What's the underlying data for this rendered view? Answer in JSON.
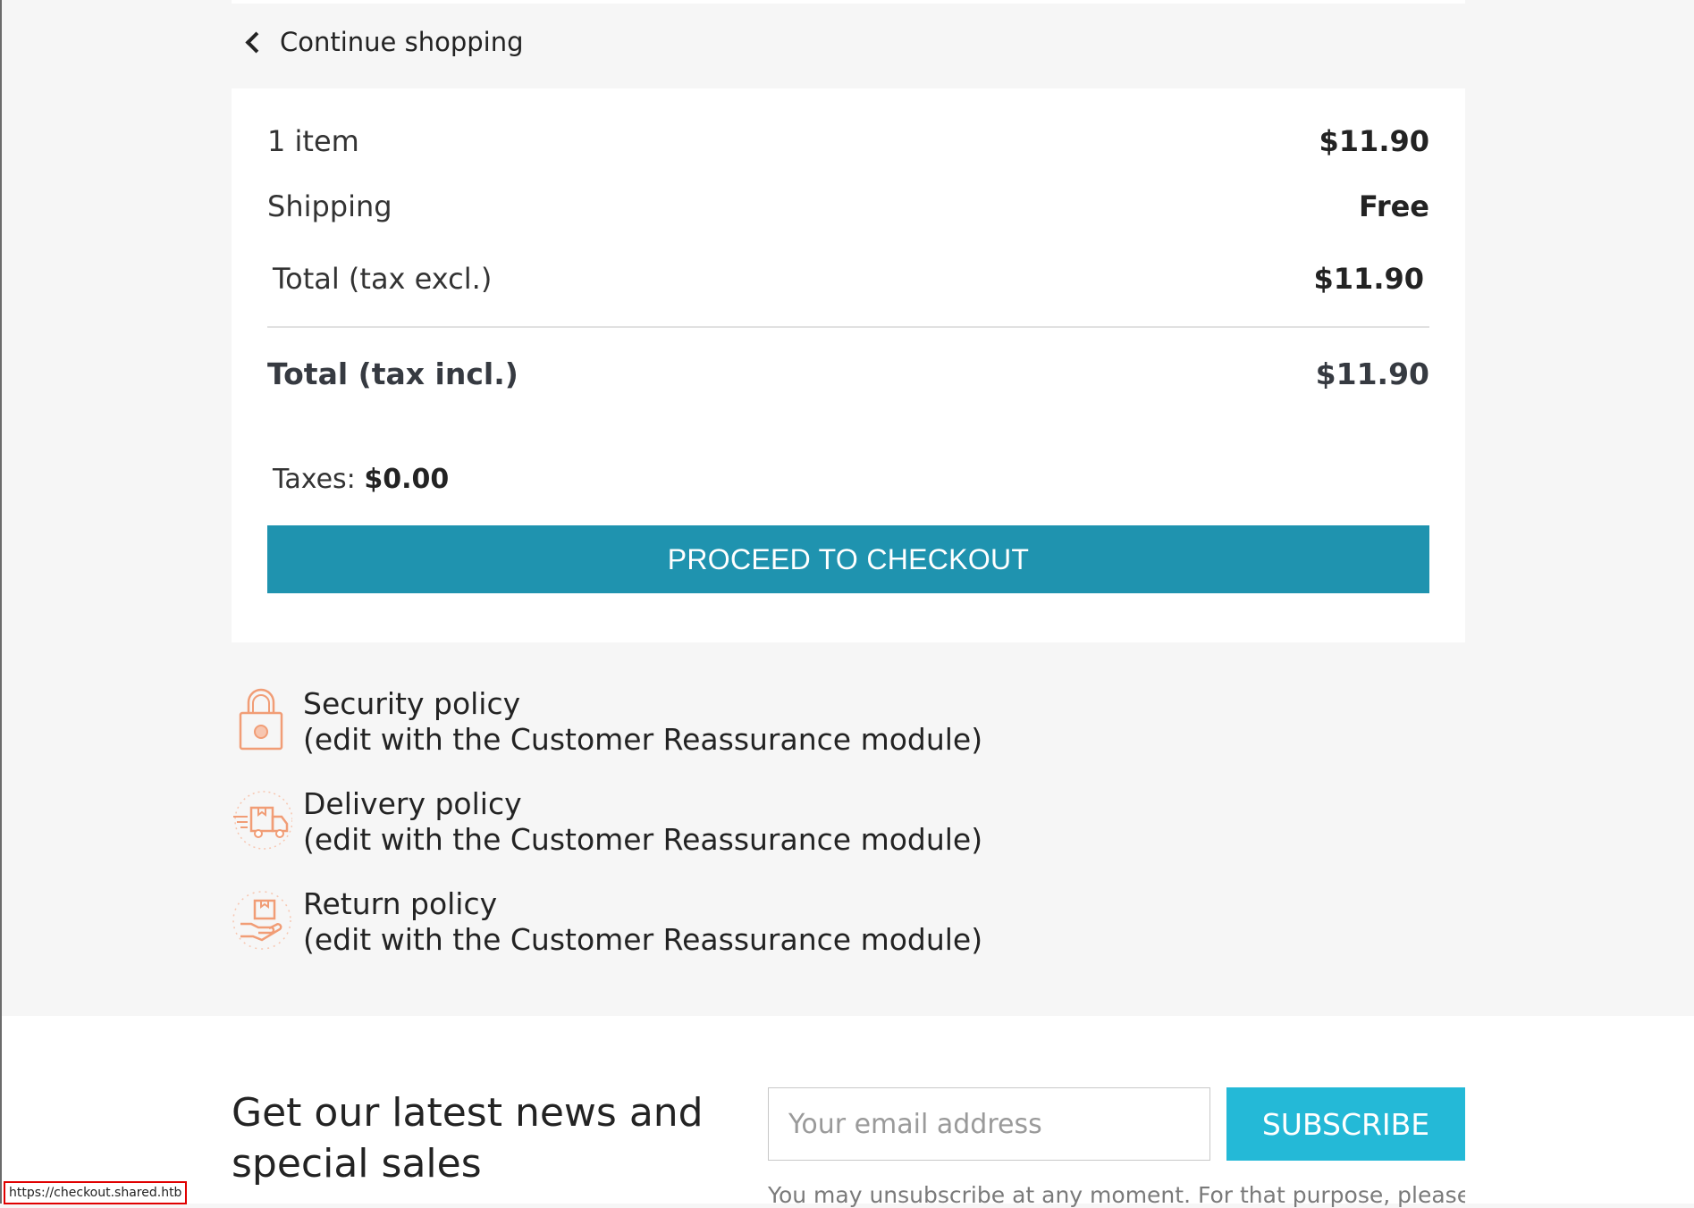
{
  "nav": {
    "continue_label": "Continue shopping"
  },
  "summary": {
    "items_label": "1 item",
    "items_value": "$11.90",
    "shipping_label": "Shipping",
    "shipping_value": "Free",
    "total_excl_label": "Total (tax excl.)",
    "total_excl_value": "$11.90",
    "total_incl_label": "Total (tax incl.)",
    "total_incl_value": "$11.90",
    "taxes_label": "Taxes:",
    "taxes_value": "$0.00",
    "checkout_label": "PROCEED TO CHECKOUT"
  },
  "reassurance": [
    {
      "icon": "lock-icon",
      "title": "Security policy",
      "subtitle": "(edit with the Customer Reassurance module)"
    },
    {
      "icon": "delivery-truck-icon",
      "title": "Delivery policy",
      "subtitle": "(edit with the Customer Reassurance module)"
    },
    {
      "icon": "return-box-icon",
      "title": "Return policy",
      "subtitle": "(edit with the Customer Reassurance module)"
    }
  ],
  "newsletter": {
    "heading": "Get our latest news and special sales",
    "email_placeholder": "Your email address",
    "subscribe_label": "SUBSCRIBE",
    "note": "You may unsubscribe at any moment. For that purpose, please find"
  },
  "status_bar": {
    "url": "https://checkout.shared.htb"
  },
  "colors": {
    "checkout_button": "#1f93af",
    "subscribe_button": "#24b9d7",
    "icon_accent": "#f19d76"
  }
}
